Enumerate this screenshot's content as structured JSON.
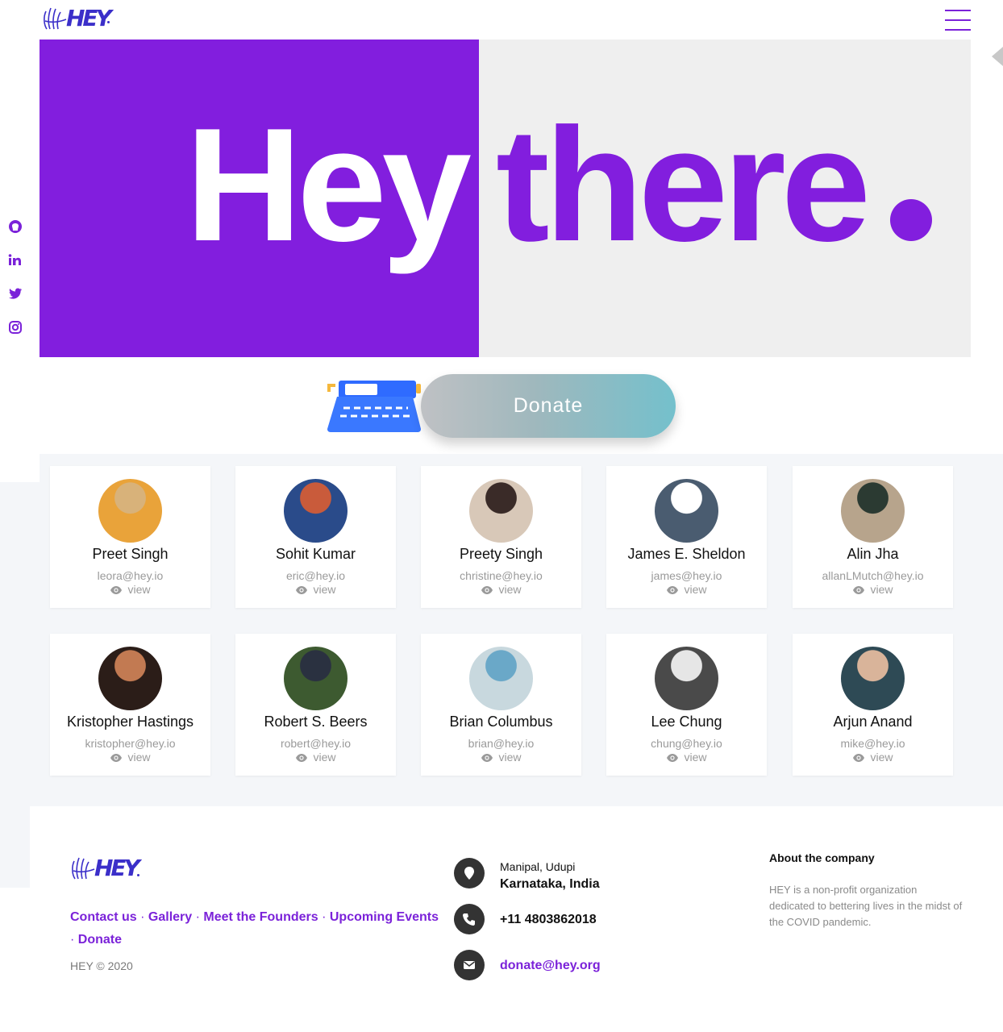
{
  "header": {
    "logo_text": "HEY",
    "menu_icon": "hamburger-icon"
  },
  "social": [
    "github-icon",
    "linkedin-icon",
    "twitter-icon",
    "instagram-icon"
  ],
  "hero": {
    "word1": "Hey",
    "word2": "there"
  },
  "donate": {
    "label": "Donate"
  },
  "team": [
    {
      "name": "Preet Singh",
      "email": "leora@hey.io",
      "view": "view"
    },
    {
      "name": "Sohit Kumar",
      "email": "eric@hey.io",
      "view": "view"
    },
    {
      "name": "Preety Singh",
      "email": "christine@hey.io",
      "view": "view"
    },
    {
      "name": "James E. Sheldon",
      "email": "james@hey.io",
      "view": "view"
    },
    {
      "name": "Alin Jha",
      "email": "allanLMutch@hey.io",
      "view": "view"
    },
    {
      "name": "Kristopher Hastings",
      "email": "kristopher@hey.io",
      "view": "view"
    },
    {
      "name": "Robert S. Beers",
      "email": "robert@hey.io",
      "view": "view"
    },
    {
      "name": "Brian Columbus",
      "email": "brian@hey.io",
      "view": "view"
    },
    {
      "name": "Lee Chung",
      "email": "chung@hey.io",
      "view": "view"
    },
    {
      "name": "Arjun Anand",
      "email": "mike@hey.io",
      "view": "view"
    }
  ],
  "footer": {
    "logo_text": "HEY",
    "links": [
      "Contact us",
      "Gallery",
      "Meet the Founders",
      "Upcoming Events",
      "Donate"
    ],
    "separator": "·",
    "copyright": "HEY © 2020",
    "address_line1": "Manipal, Udupi",
    "address_line2": "Karnataka, India",
    "phone": "+11 4803862018",
    "email": "donate@hey.org",
    "about_heading": "About the company",
    "about_text": "HEY is a non-profit organization dedicated to bettering lives in the midst of the COVID pandemic."
  },
  "colors": {
    "brand_purple": "#821ede",
    "hero_right_bg": "#efefef",
    "band_bg": "#f4f6f9"
  }
}
